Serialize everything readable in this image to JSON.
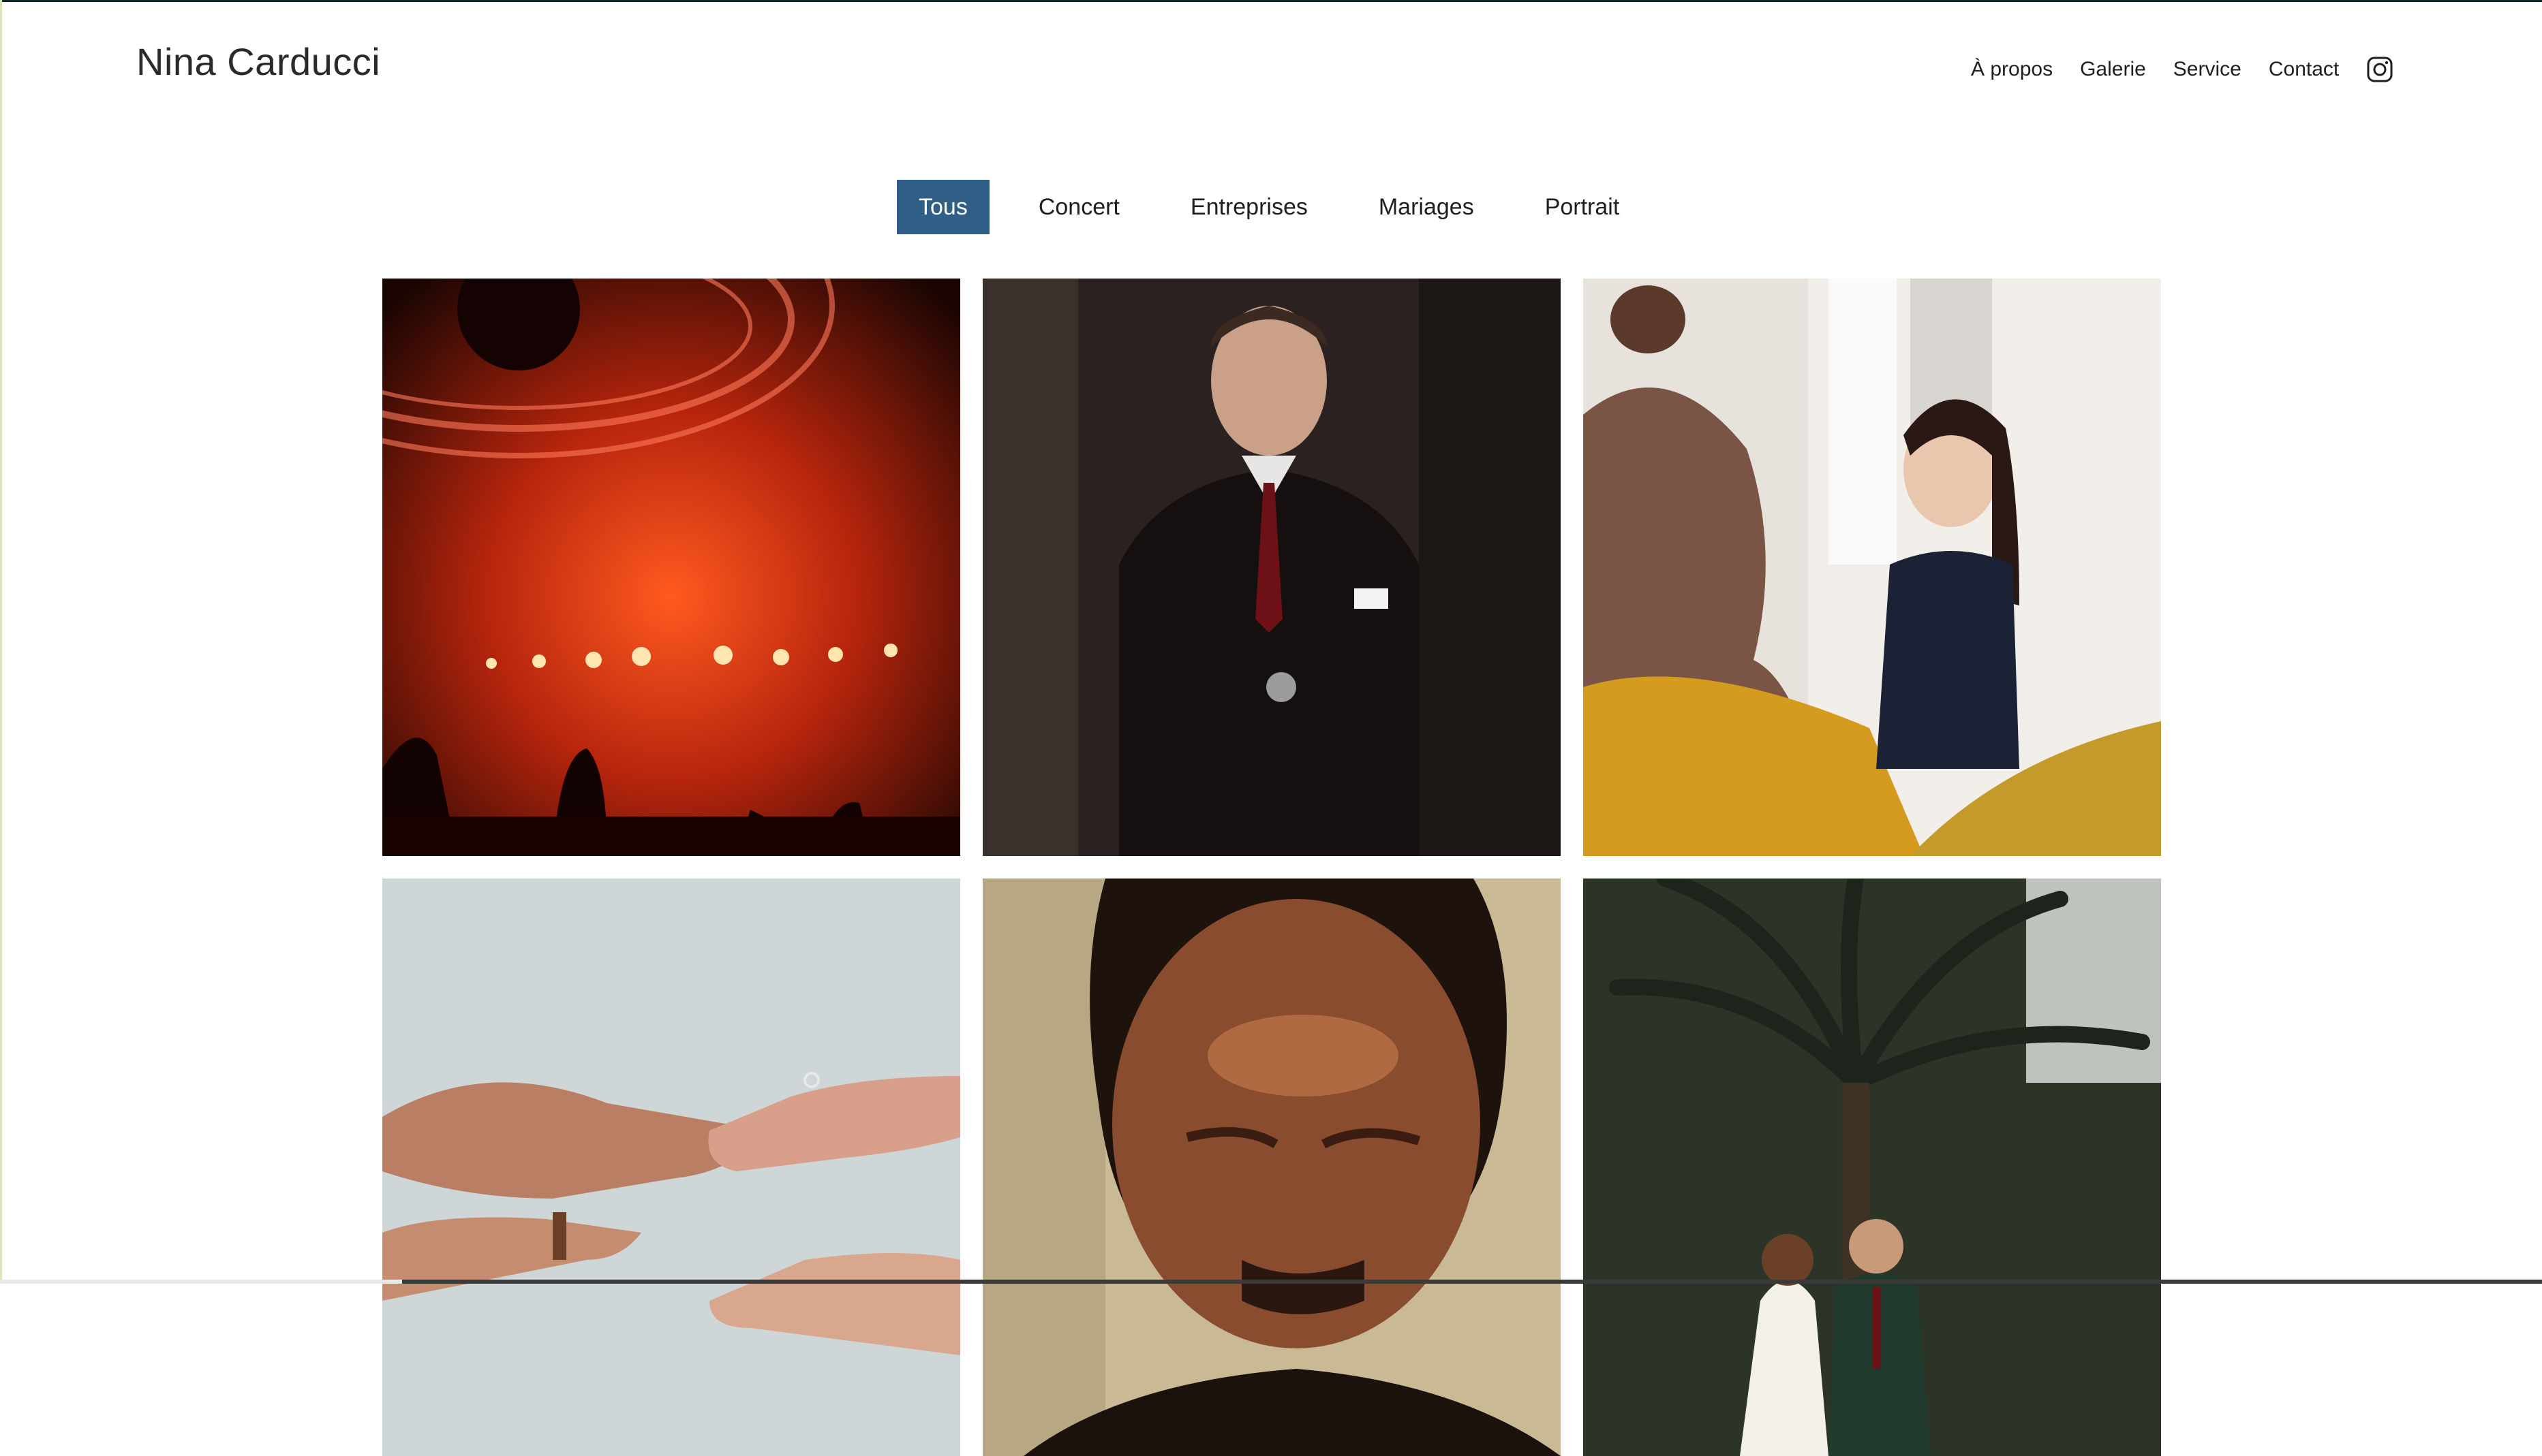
{
  "brand": {
    "name": "Nina Carducci"
  },
  "nav": {
    "items": [
      "À propos",
      "Galerie",
      "Service",
      "Contact"
    ],
    "social_icon": "instagram-icon"
  },
  "filters": {
    "items": [
      "Tous",
      "Concert",
      "Entreprises",
      "Mariages",
      "Portrait"
    ],
    "active": "Tous"
  },
  "gallery": {
    "items": [
      {
        "subject": "concert-photo",
        "icon": "concert-image"
      },
      {
        "subject": "business-man-photo",
        "icon": "portrait-image"
      },
      {
        "subject": "office-woman-photo",
        "icon": "business-image"
      },
      {
        "subject": "wedding-hands-photo",
        "icon": "wedding-image"
      },
      {
        "subject": "man-portrait-photo",
        "icon": "portrait-image"
      },
      {
        "subject": "wedding-couple-photo",
        "icon": "wedding-image"
      }
    ]
  },
  "colors": {
    "accent": "#2f5e86",
    "text": "#1f1f1f",
    "background": "#ffffff"
  }
}
